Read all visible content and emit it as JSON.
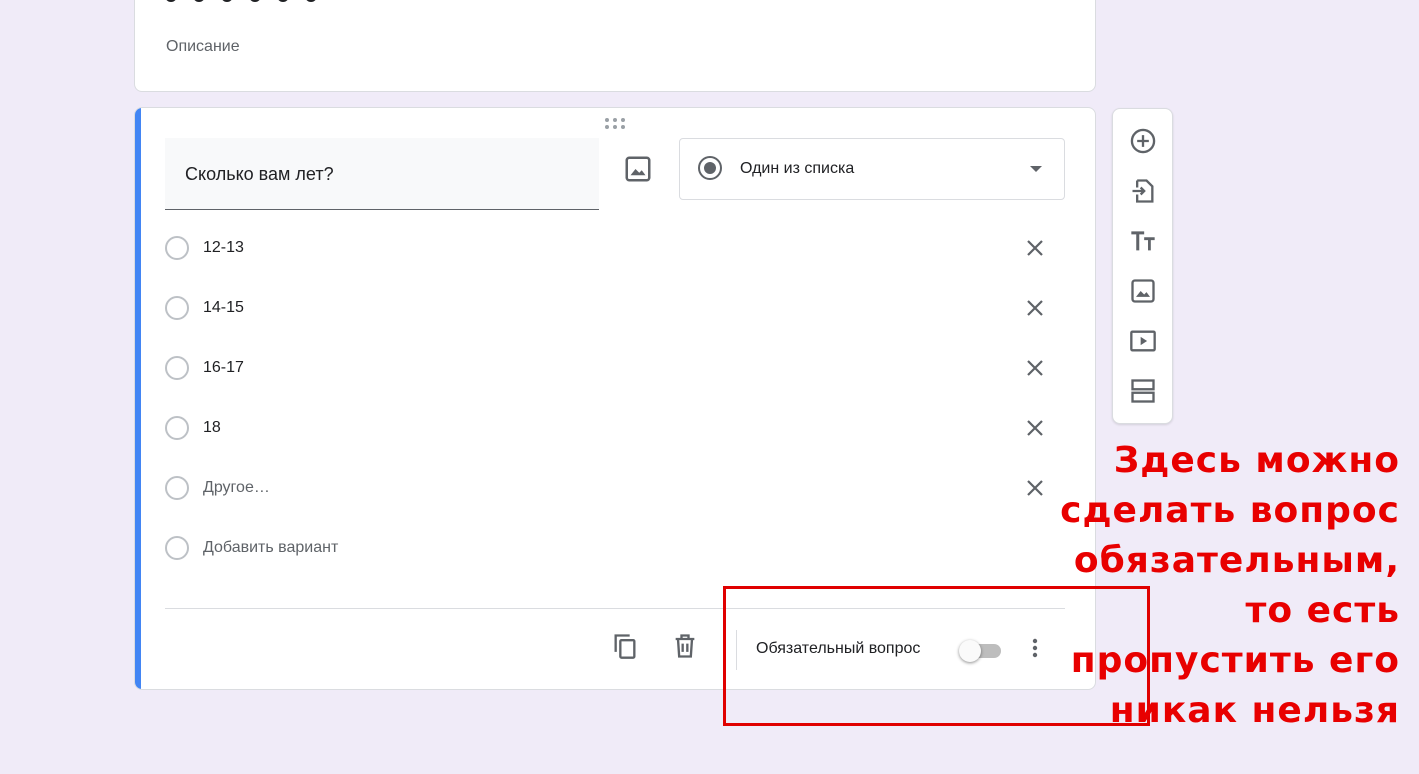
{
  "title_card": {
    "description": "Описание"
  },
  "question": {
    "text": "Сколько вам лет?",
    "type_label": "Один из списка",
    "options": [
      {
        "label": "12-13"
      },
      {
        "label": "14-15"
      },
      {
        "label": "16-17"
      },
      {
        "label": "18"
      }
    ],
    "other_label": "Другое…",
    "add_option_label": "Добавить вариант",
    "required_label": "Обязательный вопрос",
    "required_on": false
  },
  "toolbar": {
    "icons": [
      "add-question-icon",
      "import-questions-icon",
      "add-title-icon",
      "add-image-icon",
      "add-video-icon",
      "add-section-icon"
    ]
  },
  "annotation": {
    "text": "Здесь можно\nсделать вопрос\nобязательным,\nто есть\nпропустить его\nникак нельзя",
    "color": "#e80000"
  },
  "colors": {
    "accent": "#4285f4",
    "background": "#f0ebf8"
  }
}
